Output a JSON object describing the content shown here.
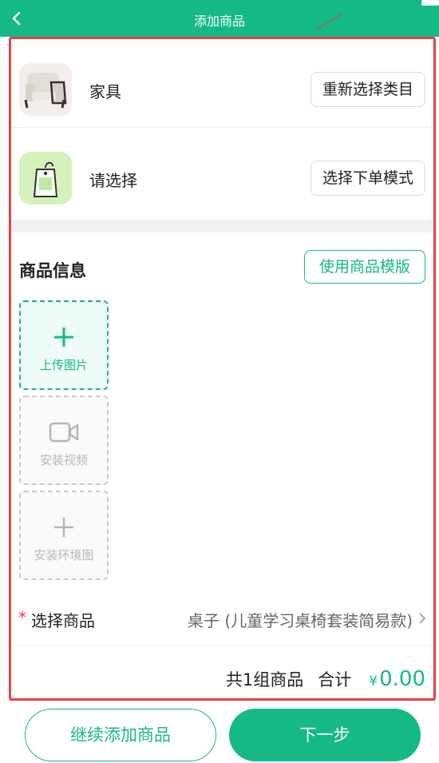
{
  "header": {
    "title": "添加商品",
    "back_icon": "chevron-left-icon",
    "accent": "#15b985"
  },
  "category": {
    "name": "家具",
    "thumb_icon": "armchair-icon",
    "action": "重新选择类目"
  },
  "order_mode": {
    "name": "请选择",
    "thumb_icon": "price-tag-icon",
    "action": "选择下单模式"
  },
  "product_info": {
    "title": "商品信息",
    "template_button": "使用商品模版",
    "tiles": [
      {
        "label": "上传图片",
        "icon": "plus-icon"
      },
      {
        "label": "安装视频",
        "icon": "video-camera-icon"
      },
      {
        "label": "安装环境图",
        "icon": "plus-icon"
      }
    ]
  },
  "select_product": {
    "required_mark": "*",
    "label": "选择商品",
    "value": "桌子 (儿童学习桌椅套装简易款)"
  },
  "summary": {
    "count_text": "共1组商品",
    "total_label": "合计",
    "currency": "¥",
    "amount": "0.00"
  },
  "footer": {
    "continue_label": "继续添加商品",
    "next_label": "下一步"
  },
  "colors": {
    "primary": "#15b985",
    "highlight_border": "#e8414b",
    "required": "#e8414b"
  }
}
